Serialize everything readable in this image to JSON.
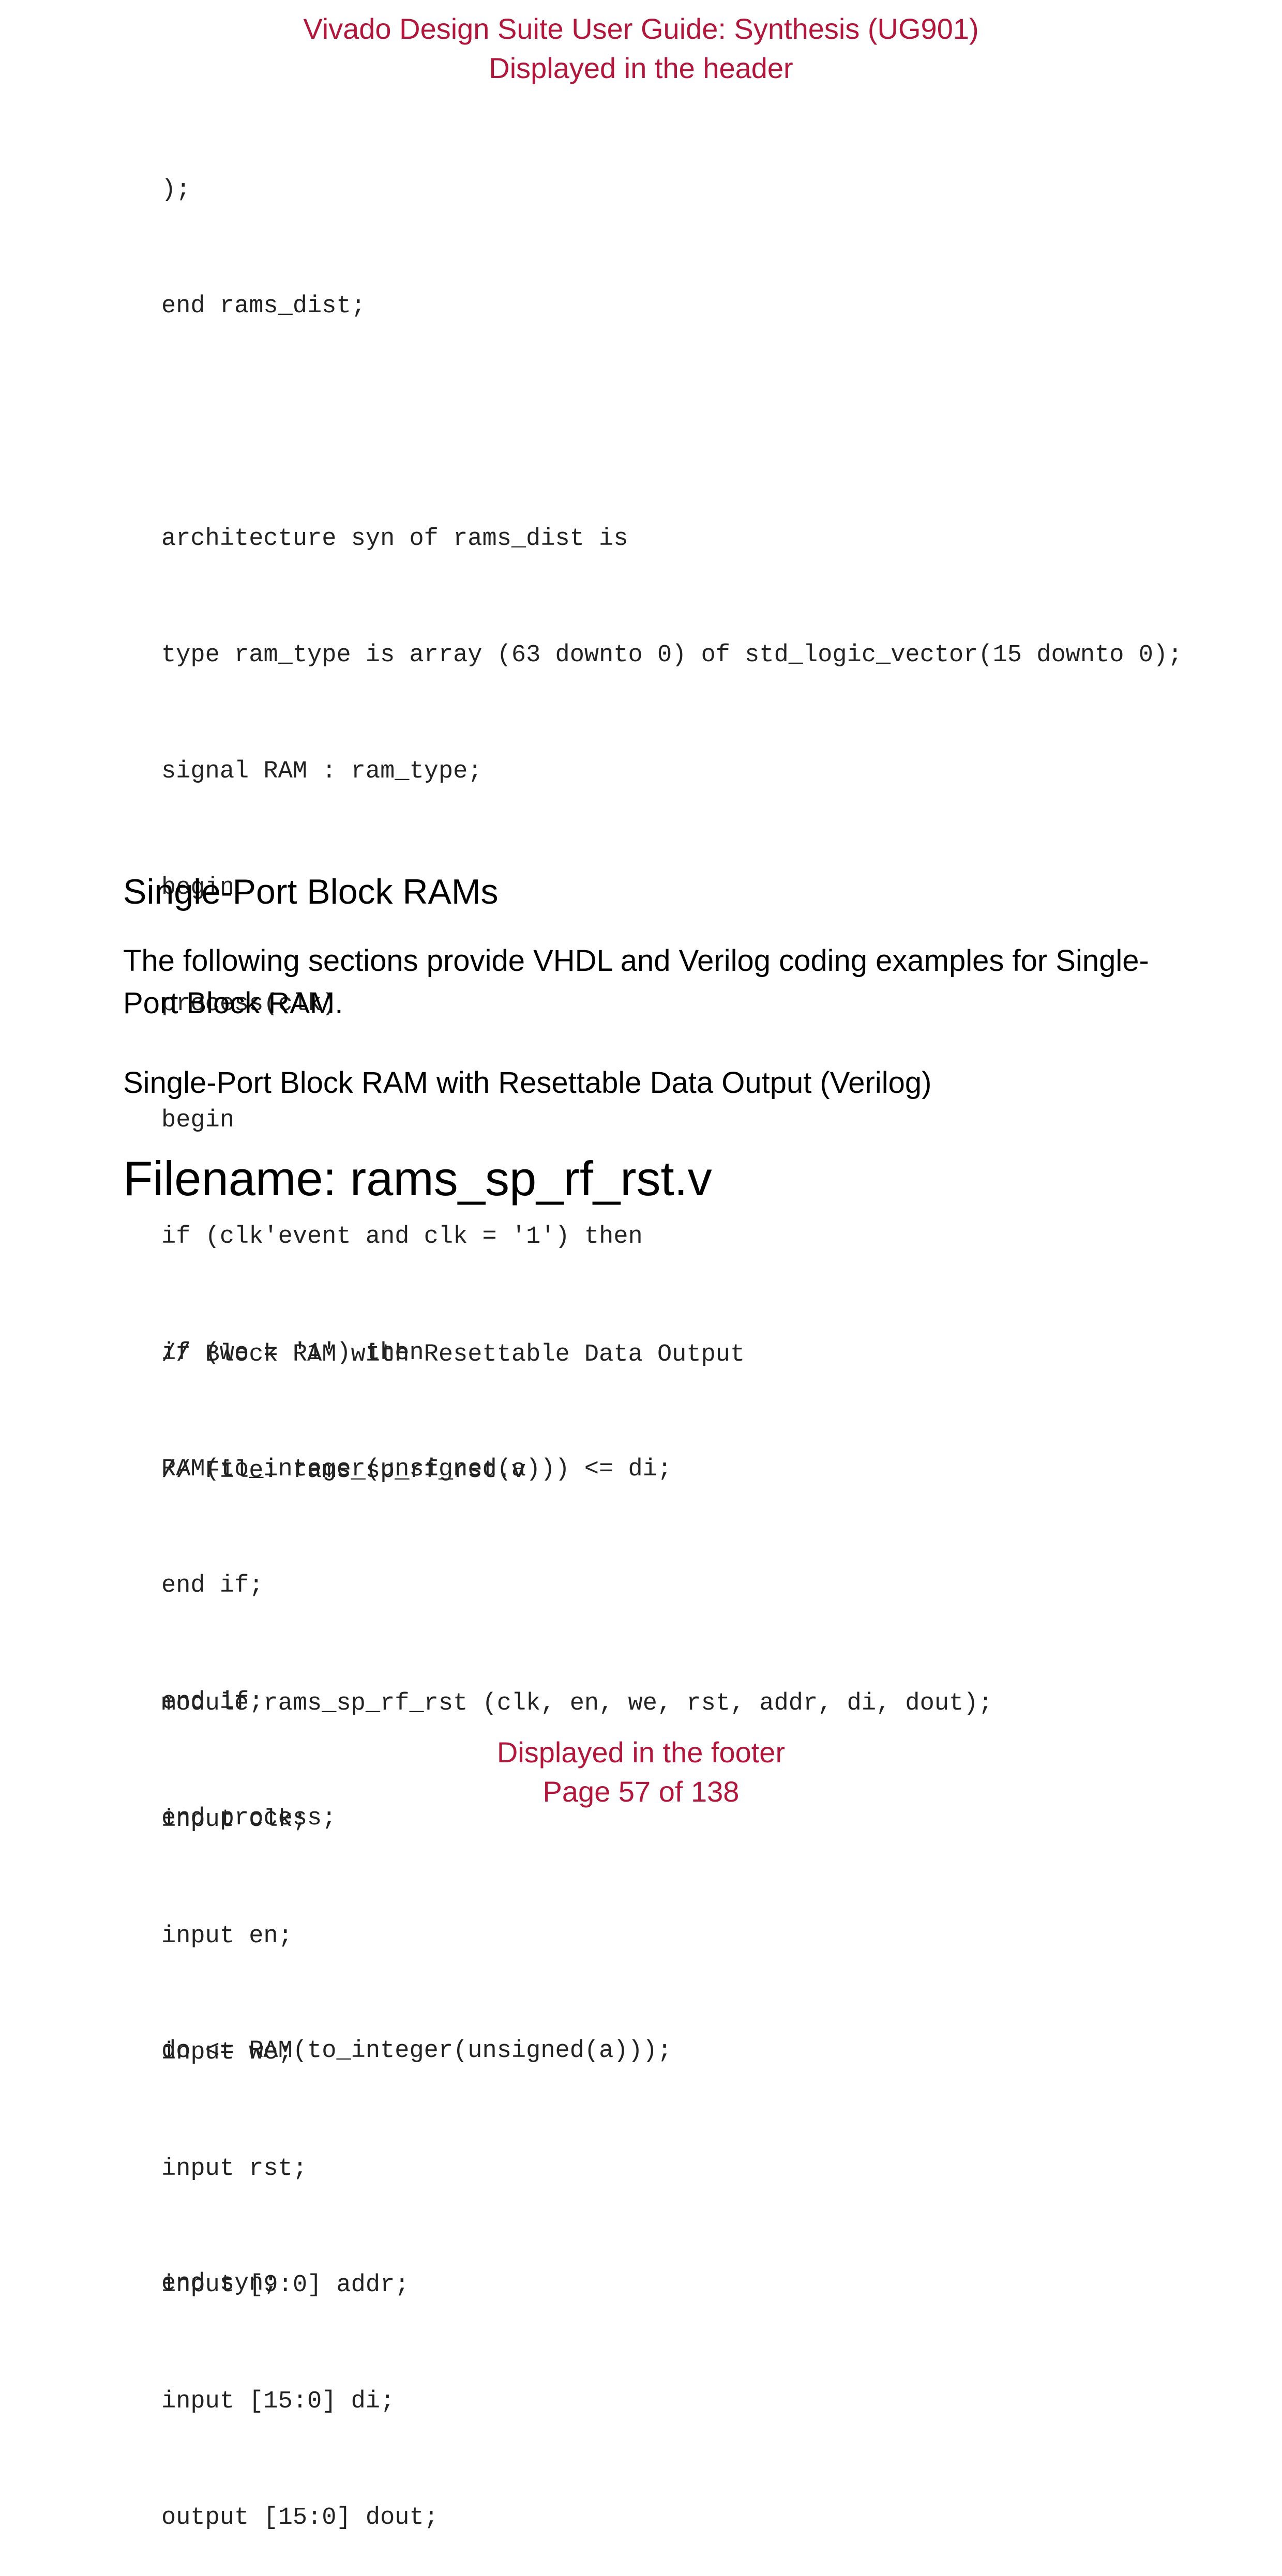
{
  "header": {
    "title": "Vivado Design Suite User Guide: Synthesis (UG901)",
    "subtitle": "Displayed in the header"
  },
  "code_top": [
    ");",
    "end rams_dist;",
    "",
    "architecture syn of rams_dist is",
    "type ram_type is array (63 downto 0) of std_logic_vector(15 downto 0);",
    "signal RAM : ram_type;",
    "begin",
    "process(clk)",
    "begin",
    "if (clk'event and clk = '1') then",
    "if (we = '1') then",
    "RAM(to_integer(unsigned(a))) <= di;",
    "end if;",
    "end if;",
    "end process;",
    "",
    "do <= RAM(to_integer(unsigned(a)));",
    "",
    "end syn;"
  ],
  "section_heading": "Single-Port Block RAMs",
  "paragraph": "The following sections provide VHDL and Verilog coding examples for Single-Port Block RAM.",
  "subheading": "Single-Port Block RAM with Resettable Data Output (Verilog)",
  "filename_heading": "Filename: rams_sp_rf_rst.v",
  "code_bottom": [
    "// Block RAM with Resettable Data Output",
    "// File: rams_sp_rf_rst.v",
    "",
    "module rams_sp_rf_rst (clk, en, we, rst, addr, di, dout);",
    "input clk;",
    "input en;",
    "input we;",
    "input rst;",
    "input [9:0] addr;",
    "input [15:0] di;",
    "output [15:0] dout;"
  ],
  "footer": {
    "label": "Displayed in the footer",
    "page": "Page 57 of 138"
  },
  "colors": {
    "accent": "#b2163a",
    "text": "#000000",
    "code_text": "#222222",
    "background": "#ffffff"
  }
}
